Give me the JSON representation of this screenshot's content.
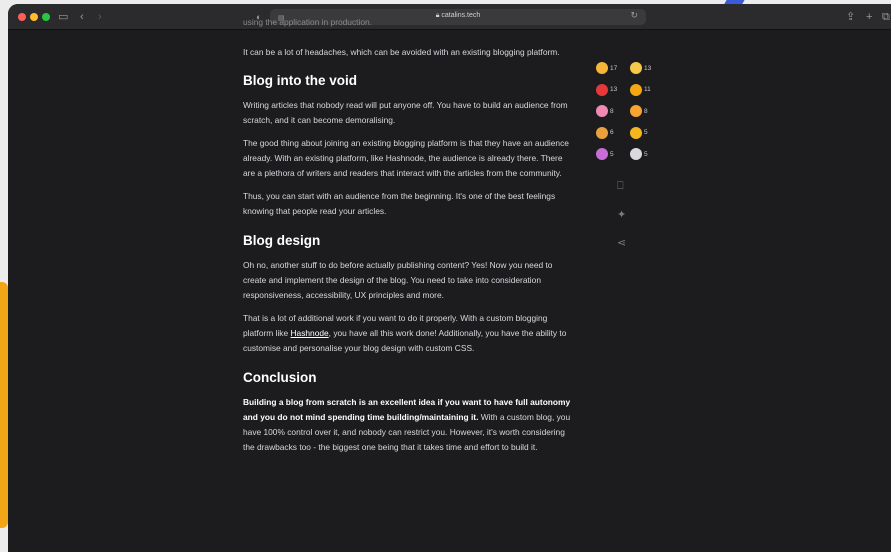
{
  "browser": {
    "url": "catalins.tech",
    "lock_icon": "lock-icon"
  },
  "article": {
    "cut_line": "using the application in production.",
    "intro": "It can be a lot of headaches, which can be avoided with an existing blogging platform.",
    "sections": [
      {
        "heading": "Blog into the void",
        "p1": "Writing articles that nobody read will put anyone off. You have to build an audience from scratch, and it can become demoralising.",
        "p2": "The good thing about joining an existing blogging platform is that they have an audience already. With an existing platform, like Hashnode, the audience is already there. There are a plethora of writers and readers that interact with the articles from the community.",
        "p3": "Thus, you can start with an audience from the beginning. It's one of the best feelings knowing that people read your articles."
      },
      {
        "heading": "Blog design",
        "p1": "Oh no, another stuff to do before actually publishing content? Yes! Now you need to create and implement the design of the blog. You need to take into consideration responsiveness, accessibility, UX principles and more.",
        "p2_before": "That is a lot of additional work if you want to do it properly. With a custom blogging platform like ",
        "p2_link": "Hashnode",
        "p2_after": ", you have all this work done! Additionally, you have the ability to customise and personalise your blog design with custom CSS."
      },
      {
        "heading": "Conclusion",
        "p1_bold": "Building a blog from scratch is an excellent idea if you want to have full autonomy and you do not mind spending time building/maintaining it.",
        "p1_rest": " With a custom blog, you have 100% control over it, and nobody can restrict you. However, it's worth considering the drawbacks too - the biggest one being that it takes time and effort to build it."
      }
    ]
  },
  "reactions": [
    {
      "icon": "clap-icon",
      "count": "17",
      "color": "#f5b63a"
    },
    {
      "icon": "thumbs-up-icon",
      "count": "13",
      "color": "#f7c948"
    },
    {
      "icon": "heart-icon",
      "count": "13",
      "color": "#e5383b"
    },
    {
      "icon": "beer-icon",
      "count": "11",
      "color": "#f3a712"
    },
    {
      "icon": "unicorn-icon",
      "count": "8",
      "color": "#f08ab2"
    },
    {
      "icon": "hugging-face-icon",
      "count": "8",
      "color": "#f7a531"
    },
    {
      "icon": "money-bag-icon",
      "count": "6",
      "color": "#e9a23b"
    },
    {
      "icon": "trophy-icon",
      "count": "5",
      "color": "#f3b61f"
    },
    {
      "icon": "party-popper-icon",
      "count": "5",
      "color": "#c86dd7"
    },
    {
      "icon": "rocket-icon",
      "count": "5",
      "color": "#d9d9de"
    }
  ],
  "side_actions": [
    {
      "icon": "bookmark-icon"
    },
    {
      "icon": "twitter-icon"
    },
    {
      "icon": "share-icon"
    }
  ]
}
